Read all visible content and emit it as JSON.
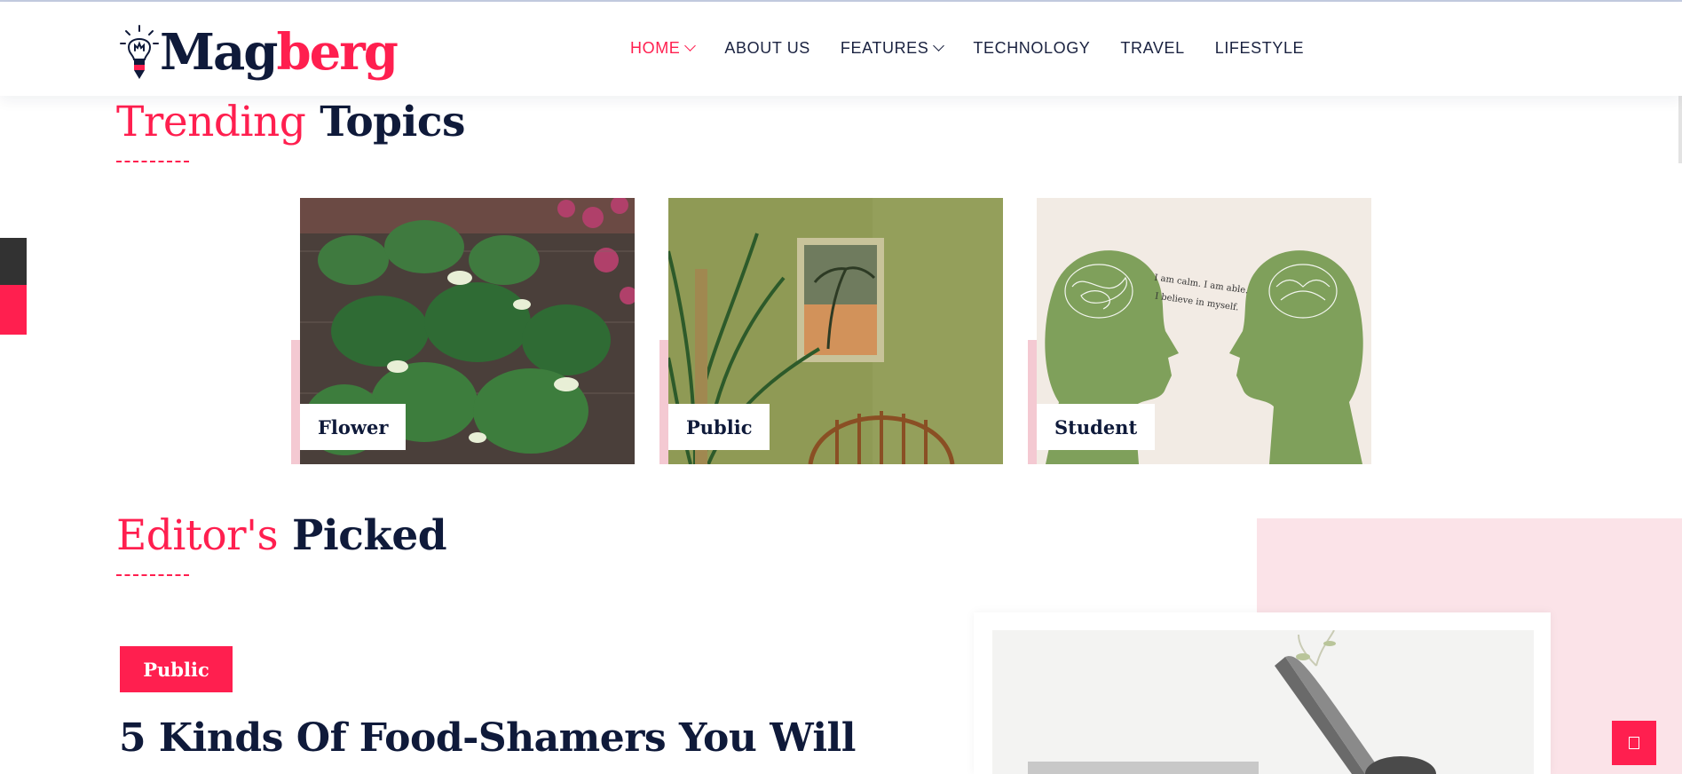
{
  "brand": {
    "logo_part1": "Mag",
    "logo_part2": "berg",
    "accent": "#ff1f4f",
    "dark": "#0f1a3a"
  },
  "nav": {
    "items": [
      {
        "label": "HOME",
        "active": true,
        "dropdown": true
      },
      {
        "label": "ABOUT US",
        "active": false,
        "dropdown": false
      },
      {
        "label": "FEATURES",
        "active": false,
        "dropdown": true
      },
      {
        "label": "TECHNOLOGY",
        "active": false,
        "dropdown": false
      },
      {
        "label": "TRAVEL",
        "active": false,
        "dropdown": false
      },
      {
        "label": "LIFESTYLE",
        "active": false,
        "dropdown": false
      }
    ]
  },
  "trending": {
    "title_highlight": "Trending",
    "title_rest": "Topics",
    "cards": [
      {
        "label": "Flower"
      },
      {
        "label": "Public"
      },
      {
        "label": "Student",
        "image_text_1": "I am calm. I am able.",
        "image_text_2": "I believe in myself."
      }
    ]
  },
  "editors": {
    "title_highlight": "Editor's",
    "title_rest": "Picked",
    "post": {
      "category": "Public",
      "title": "5 Kinds Of Food-Shamers You Will"
    }
  },
  "icons": {
    "scroll_top": "scroll-top-icon",
    "logo": "lightbulb-pencil-icon"
  }
}
